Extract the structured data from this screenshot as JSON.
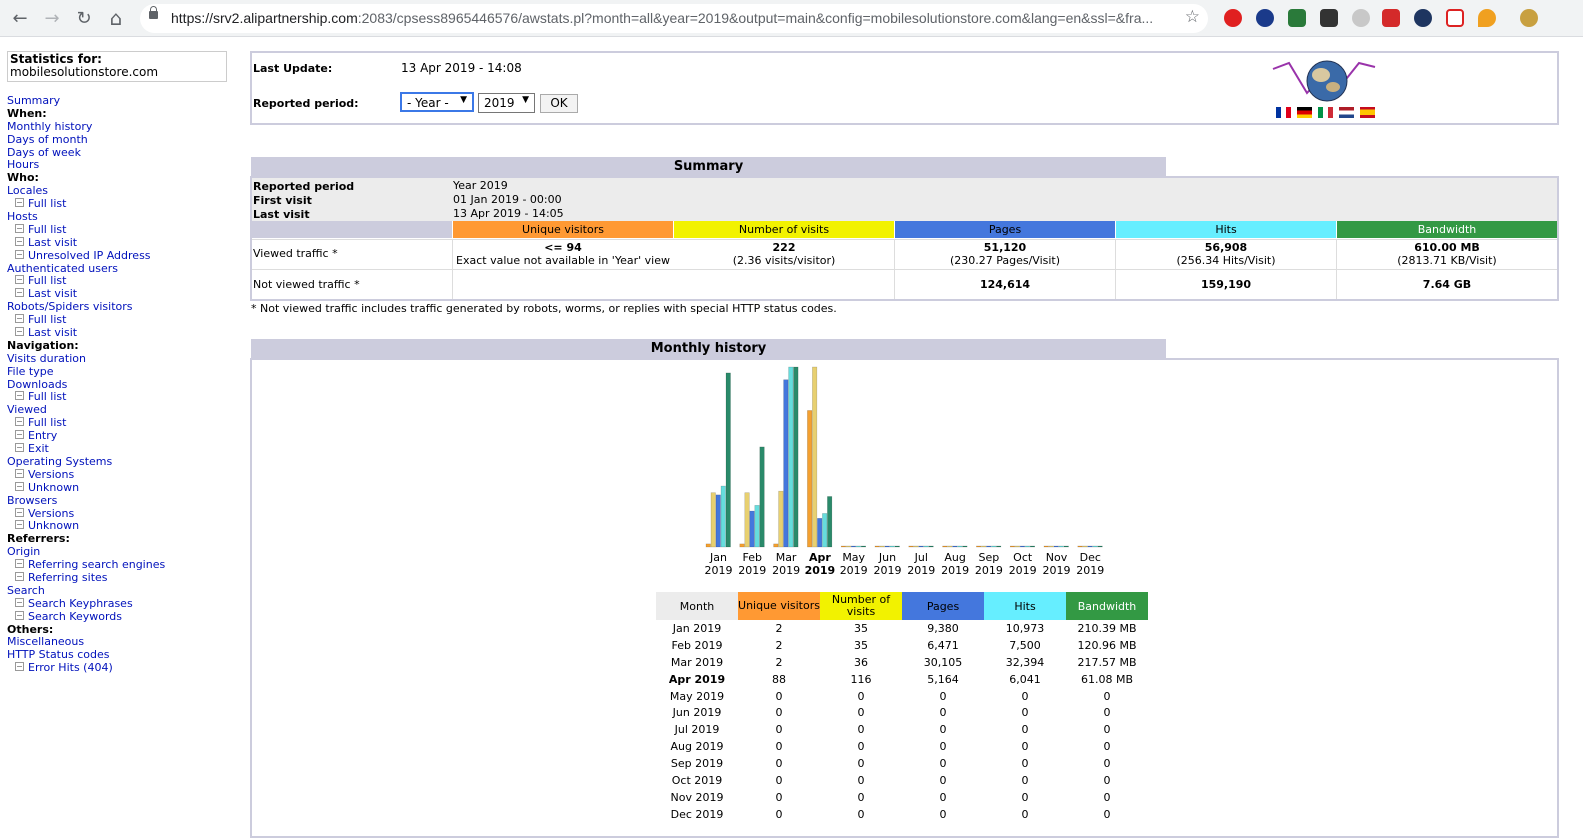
{
  "browser": {
    "url_host": "https://srv2.alipartnership.com",
    "url_rest": ":2083/cpsess8965446576/awstats.pl?month=all&year=2019&output=main&config=mobilesolutionstore.com&lang=en&ssl=&fra...",
    "back_icon": "←",
    "forward_icon": "→",
    "reload_icon": "↻",
    "home_icon": "⌂",
    "star_icon": "☆"
  },
  "sidebar": {
    "stats_for_label": "Statistics for:",
    "site": "mobilesolutionstore.com",
    "items": [
      {
        "t": "lnk",
        "label": "Summary"
      },
      {
        "t": "hdr",
        "label": "When:"
      },
      {
        "t": "lnk",
        "label": "Monthly history"
      },
      {
        "t": "lnk",
        "label": "Days of month"
      },
      {
        "t": "lnk",
        "label": "Days of week"
      },
      {
        "t": "lnk",
        "label": "Hours"
      },
      {
        "t": "hdr",
        "label": "Who:"
      },
      {
        "t": "lnk",
        "label": "Locales"
      },
      {
        "t": "sub",
        "label": "Full list"
      },
      {
        "t": "lnk",
        "label": "Hosts"
      },
      {
        "t": "sub",
        "label": "Full list"
      },
      {
        "t": "sub",
        "label": "Last visit"
      },
      {
        "t": "sub",
        "label": "Unresolved IP Address"
      },
      {
        "t": "lnk",
        "label": "Authenticated users"
      },
      {
        "t": "sub",
        "label": "Full list"
      },
      {
        "t": "sub",
        "label": "Last visit"
      },
      {
        "t": "lnk",
        "label": "Robots/Spiders visitors"
      },
      {
        "t": "sub",
        "label": "Full list"
      },
      {
        "t": "sub",
        "label": "Last visit"
      },
      {
        "t": "hdr",
        "label": "Navigation:"
      },
      {
        "t": "lnk",
        "label": "Visits duration"
      },
      {
        "t": "lnk",
        "label": "File type"
      },
      {
        "t": "lnk",
        "label": "Downloads"
      },
      {
        "t": "sub",
        "label": "Full list"
      },
      {
        "t": "lnk",
        "label": "Viewed"
      },
      {
        "t": "sub",
        "label": "Full list"
      },
      {
        "t": "sub",
        "label": "Entry"
      },
      {
        "t": "sub",
        "label": "Exit"
      },
      {
        "t": "lnk",
        "label": "Operating Systems"
      },
      {
        "t": "sub",
        "label": "Versions"
      },
      {
        "t": "sub",
        "label": "Unknown"
      },
      {
        "t": "lnk",
        "label": "Browsers"
      },
      {
        "t": "sub",
        "label": "Versions"
      },
      {
        "t": "sub",
        "label": "Unknown"
      },
      {
        "t": "hdr",
        "label": "Referrers:"
      },
      {
        "t": "lnk",
        "label": "Origin"
      },
      {
        "t": "sub",
        "label": "Referring search engines"
      },
      {
        "t": "sub",
        "label": "Referring sites"
      },
      {
        "t": "lnk",
        "label": "Search"
      },
      {
        "t": "sub",
        "label": "Search Keyphrases"
      },
      {
        "t": "sub",
        "label": "Search Keywords"
      },
      {
        "t": "hdr",
        "label": "Others:"
      },
      {
        "t": "lnk",
        "label": "Miscellaneous"
      },
      {
        "t": "lnk",
        "label": "HTTP Status codes"
      },
      {
        "t": "sub",
        "label": "Error Hits (404)"
      }
    ]
  },
  "header": {
    "last_update_label": "Last Update:",
    "last_update_value": "13 Apr 2019 - 14:08",
    "reported_period_label": "Reported period:",
    "period_select": "- Year -",
    "year_select": "2019",
    "ok_label": "OK"
  },
  "summary": {
    "title": "Summary",
    "reported_period_label": "Reported period",
    "reported_period_value": "Year 2019",
    "first_visit_label": "First visit",
    "first_visit_value": "01 Jan 2019 - 00:00",
    "last_visit_label": "Last visit",
    "last_visit_value": "13 Apr 2019 - 14:05",
    "col_unique": "Unique visitors",
    "col_visits": "Number of visits",
    "col_pages": "Pages",
    "col_hits": "Hits",
    "col_bandwidth": "Bandwidth",
    "viewed_label": "Viewed traffic *",
    "viewed_unique": "<= 94",
    "viewed_unique_note": "Exact value not available in 'Year' view",
    "viewed_visits": "222",
    "viewed_visits_note": "(2.36 visits/visitor)",
    "viewed_pages": "51,120",
    "viewed_pages_note": "(230.27 Pages/Visit)",
    "viewed_hits": "56,908",
    "viewed_hits_note": "(256.34 Hits/Visit)",
    "viewed_bw": "610.00 MB",
    "viewed_bw_note": "(2813.71 KB/Visit)",
    "notviewed_label": "Not viewed traffic *",
    "notviewed_pages": "124,614",
    "notviewed_hits": "159,190",
    "notviewed_bw": "7.64 GB",
    "footnote": "* Not viewed traffic includes traffic generated by robots, worms, or replies with special HTTP status codes."
  },
  "history": {
    "title": "Monthly history",
    "col_month": "Month",
    "col_unique": "Unique visitors",
    "col_visits": "Number of visits",
    "col_pages": "Pages",
    "col_hits": "Hits",
    "col_bandwidth": "Bandwidth",
    "rows": [
      {
        "month": "Jan 2019",
        "u": "2",
        "v": "35",
        "p": "9,380",
        "h": "10,973",
        "b": "210.39 MB"
      },
      {
        "month": "Feb 2019",
        "u": "2",
        "v": "35",
        "p": "6,471",
        "h": "7,500",
        "b": "120.96 MB"
      },
      {
        "month": "Mar 2019",
        "u": "2",
        "v": "36",
        "p": "30,105",
        "h": "32,394",
        "b": "217.57 MB"
      },
      {
        "month": "Apr 2019",
        "u": "88",
        "v": "116",
        "p": "5,164",
        "h": "6,041",
        "b": "61.08 MB",
        "bold": true
      },
      {
        "month": "May 2019",
        "u": "0",
        "v": "0",
        "p": "0",
        "h": "0",
        "b": "0"
      },
      {
        "month": "Jun 2019",
        "u": "0",
        "v": "0",
        "p": "0",
        "h": "0",
        "b": "0"
      },
      {
        "month": "Jul 2019",
        "u": "0",
        "v": "0",
        "p": "0",
        "h": "0",
        "b": "0"
      },
      {
        "month": "Aug 2019",
        "u": "0",
        "v": "0",
        "p": "0",
        "h": "0",
        "b": "0"
      },
      {
        "month": "Sep 2019",
        "u": "0",
        "v": "0",
        "p": "0",
        "h": "0",
        "b": "0"
      },
      {
        "month": "Oct 2019",
        "u": "0",
        "v": "0",
        "p": "0",
        "h": "0",
        "b": "0"
      },
      {
        "month": "Nov 2019",
        "u": "0",
        "v": "0",
        "p": "0",
        "h": "0",
        "b": "0"
      },
      {
        "month": "Dec 2019",
        "u": "0",
        "v": "0",
        "p": "0",
        "h": "0",
        "b": "0"
      }
    ]
  },
  "chart_data": {
    "type": "bar",
    "categories": [
      "Jan",
      "Feb",
      "Mar",
      "Apr",
      "May",
      "Jun",
      "Jul",
      "Aug",
      "Sep",
      "Oct",
      "Nov",
      "Dec"
    ],
    "category_years": [
      "2019",
      "2019",
      "2019",
      "2019",
      "2019",
      "2019",
      "2019",
      "2019",
      "2019",
      "2019",
      "2019",
      "2019"
    ],
    "highlight": "Apr",
    "series": [
      {
        "name": "Unique visitors",
        "color": "#f4a030",
        "values": [
          2,
          2,
          2,
          88,
          0,
          0,
          0,
          0,
          0,
          0,
          0,
          0
        ]
      },
      {
        "name": "Number of visits",
        "color": "#e8d070",
        "values": [
          35,
          35,
          36,
          116,
          0,
          0,
          0,
          0,
          0,
          0,
          0,
          0
        ]
      },
      {
        "name": "Pages",
        "color": "#4477dd",
        "values": [
          9380,
          6471,
          30105,
          5164,
          0,
          0,
          0,
          0,
          0,
          0,
          0,
          0
        ]
      },
      {
        "name": "Hits",
        "color": "#66dddd",
        "values": [
          10973,
          7500,
          32394,
          6041,
          0,
          0,
          0,
          0,
          0,
          0,
          0,
          0
        ]
      },
      {
        "name": "Bandwidth",
        "color": "#2a8a6a",
        "values": [
          210.39,
          120.96,
          217.57,
          61.08,
          0,
          0,
          0,
          0,
          0,
          0,
          0,
          0
        ]
      }
    ],
    "units": {
      "Bandwidth": "MB"
    }
  },
  "colors": {
    "unique": "#ff9933",
    "visits": "#f2f200",
    "pages": "#4477dd",
    "hits": "#66eeff",
    "bandwidth": "#339944",
    "section": "#ccccdd",
    "link": "#0011bb"
  }
}
